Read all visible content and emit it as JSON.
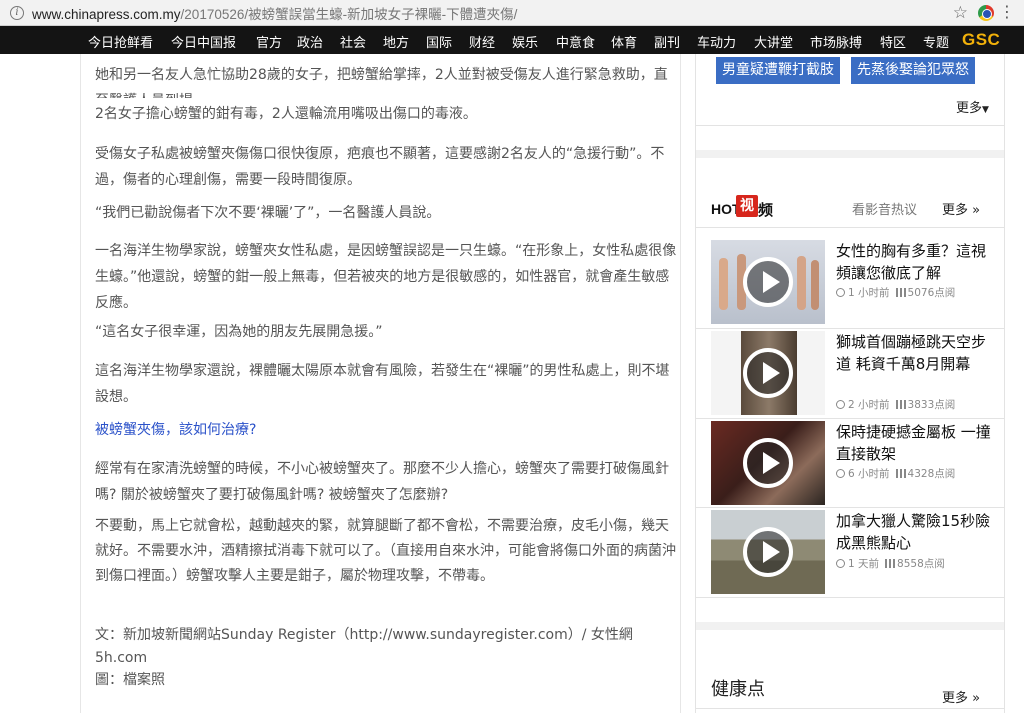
{
  "browser": {
    "url_host": "www.chinapress.com.my",
    "url_path": "/20170526/被螃蟹誤當生蠔-新加坡女子裸曬-下體遭夾傷/"
  },
  "nav": {
    "items": [
      "今日抢鲜看",
      "今日中国报",
      "官方",
      "政治",
      "社会",
      "地方",
      "国际",
      "财经",
      "娱乐",
      "中意食",
      "体育",
      "副刊",
      "车动力",
      "大讲堂",
      "市场脉搏",
      "特区",
      "专题"
    ],
    "logo": "GSC"
  },
  "article": {
    "paragraphs": [
      "她和另一名友人急忙協助28歲的女子，把螃蟹給掌摔，2人並對被受傷友人進行緊急救助，直至醫護人員到場。",
      "2名女子擔心螃蟹的鉗有毒，2人還輪流用嘴吸出傷口的毒液。",
      "受傷女子私處被螃蟹夾傷傷口很快復原，疤痕也不顯著，這要感謝2名友人的“急援行動”。不過，傷者的心理創傷，需要一段時間復原。",
      "“我們已勸說傷者下次不要‘裸曬’了”，一名醫護人員說。",
      "一名海洋生物學家說，螃蟹夾女性私處，是因螃蟹誤認是一只生蠔。“在形象上，女性私處很像生蠔。”他還說，螃蟹的鉗一般上無毒，但若被夾的地方是很敏感的，如性器官，就會產生敏感反應。",
      "“這名女子很幸運，因為她的朋友先展開急援。”",
      "這名海洋生物學家還說，裸體曬太陽原本就會有風險，若發生在“裸曬”的男性私處上，則不堪設想。"
    ],
    "subheading": "被螃蟹夾傷，該如何治療?",
    "paragraphs2": [
      "經常有在家清洗螃蟹的時候，不小心被螃蟹夾了。那麼不少人擔心，螃蟹夾了需要打破傷風針嗎? 關於被螃蟹夾了要打破傷風針嗎? 被螃蟹夾了怎麼辦?",
      "不要動，馬上它就會松，越動越夾的緊，就算腿斷了都不會松，不需要治療，皮毛小傷，幾天就好。不需要水沖，酒精擦拭消毒下就可以了。（直接用自來水沖，可能會將傷口外面的病菌沖到傷口裡面。）螃蟹攻擊人主要是鉗子，屬於物理攻擊，不帶毒。"
    ],
    "source": "文：新加坡新聞網站Sunday Register（http://www.sundayregister.com）/ 女性網5h.com",
    "photo": "圖：檔案照"
  },
  "sidebar": {
    "tags": [
      "男童疑遭鞭打截肢",
      "先蒸後娶論犯眾怒"
    ],
    "more_label": "更多",
    "hot": {
      "logo_hot": "HOT",
      "logo_shi": "视",
      "logo_pin": "频",
      "subtitle": "看影音热议",
      "more_label": "更多 »"
    },
    "videos": [
      {
        "title": "女性的胸有多重？這視頻讓您徹底了解",
        "time": "1 小时前",
        "views": "5076点阅"
      },
      {
        "title": "獅城首個蹦極跳天空步道 耗資千萬8月開幕",
        "time": "2 小时前",
        "views": "3833点阅"
      },
      {
        "title": "保時捷硬撼金屬板 一撞直接散架",
        "time": "6 小时前",
        "views": "4328点阅"
      },
      {
        "title": "加拿大獵人驚險15秒險成黑熊點心",
        "time": "1 天前",
        "views": "8558点阅"
      }
    ],
    "health": {
      "title": "健康点",
      "more_label": "更多 »"
    }
  },
  "colors": {
    "nav_bg": "#141414",
    "tag_bg": "#3a6dc4",
    "link": "#2a51c9",
    "hot_red": "#d7261c",
    "logo_gold": "#f2b10a"
  }
}
